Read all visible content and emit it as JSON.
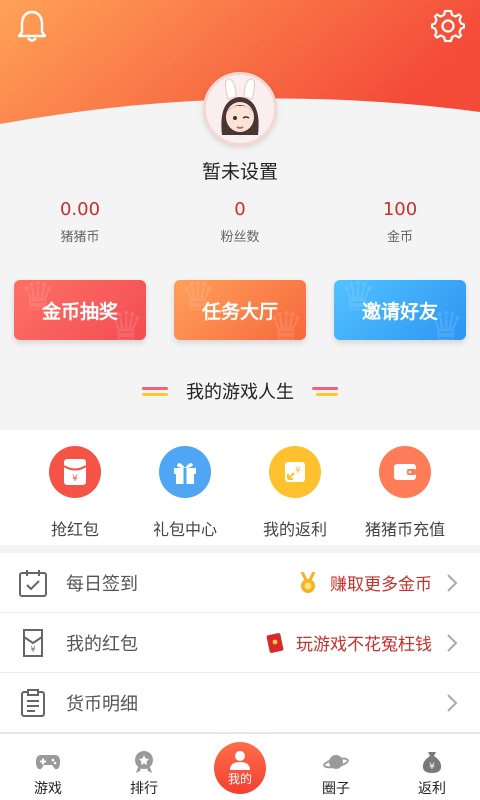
{
  "colors": {
    "header_start": "#ff9a55",
    "header_end": "#f44b38",
    "accent_red": "#c9302c"
  },
  "header": {
    "bell_icon": "bell-icon",
    "settings_icon": "gear-icon"
  },
  "profile": {
    "username": "暂未设置",
    "avatar": "bunny-girl-avatar"
  },
  "stats": [
    {
      "value": "0.00",
      "label": "猪猪币"
    },
    {
      "value": "0",
      "label": "粉丝数"
    },
    {
      "value": "100",
      "label": "金币"
    }
  ],
  "actions": [
    {
      "label": "金币抽奖"
    },
    {
      "label": "任务大厅"
    },
    {
      "label": "邀请好友"
    }
  ],
  "section": {
    "title": "我的游戏人生"
  },
  "features": [
    {
      "label": "抢红包",
      "icon": "red-envelope-icon"
    },
    {
      "label": "礼包中心",
      "icon": "gift-icon"
    },
    {
      "label": "我的返利",
      "icon": "rebate-icon"
    },
    {
      "label": "猪猪币充值",
      "icon": "wallet-icon"
    }
  ],
  "list": [
    {
      "label": "每日签到",
      "right_text": "赚取更多金币",
      "icon": "checkin-icon"
    },
    {
      "label": "我的红包",
      "right_text": "玩游戏不花冤枉钱",
      "icon": "envelope-icon"
    },
    {
      "label": "货币明细",
      "right_text": "",
      "icon": "clipboard-icon"
    }
  ],
  "tabbar": [
    {
      "label": "游戏",
      "icon": "gamepad-icon"
    },
    {
      "label": "排行",
      "icon": "ranking-icon"
    },
    {
      "label": "我的",
      "icon": "user-icon"
    },
    {
      "label": "圈子",
      "icon": "planet-icon"
    },
    {
      "label": "返利",
      "icon": "moneybag-icon"
    }
  ]
}
